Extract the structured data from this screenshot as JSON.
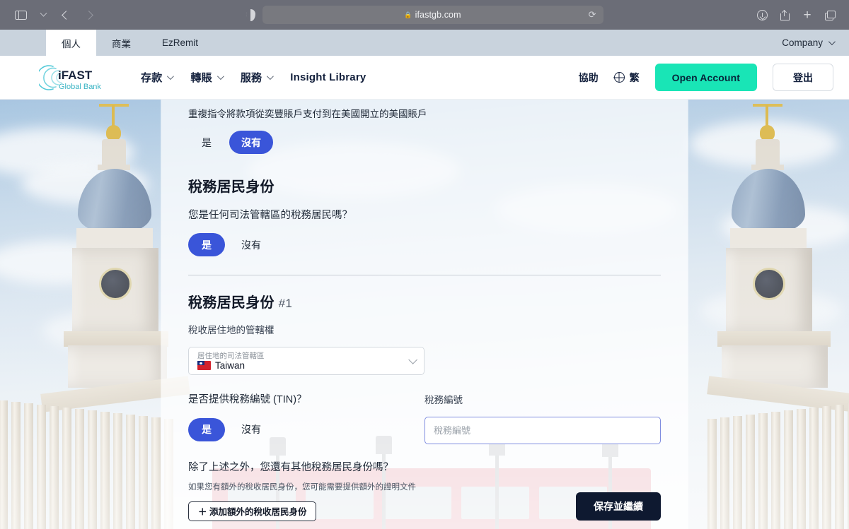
{
  "browser": {
    "url": "ifastgb.com",
    "lock_icon": "lock-icon",
    "sidebar_icon": "sidebar-toggle-icon",
    "back_icon": "back-arrow-icon",
    "forward_icon": "forward-arrow-icon",
    "shield_icon": "privacy-shield-icon",
    "reload_icon": "reload-icon",
    "download_icon": "download-icon",
    "share_icon": "share-icon",
    "newtab_icon": "plus-icon",
    "tabs_icon": "tab-overview-icon"
  },
  "tabstrip": {
    "tabs": [
      {
        "label": "個人",
        "active": true
      },
      {
        "label": "商業",
        "active": false
      },
      {
        "label": "EzRemit",
        "active": false
      }
    ],
    "company_label": "Company"
  },
  "sitenav": {
    "logo_primary": "iFAST",
    "logo_secondary": "Global Bank",
    "links": [
      {
        "label": "存款",
        "caret": true
      },
      {
        "label": "轉賬",
        "caret": true
      },
      {
        "label": "服務",
        "caret": true
      },
      {
        "label": "Insight Library",
        "caret": false
      }
    ],
    "help_label": "協助",
    "lang_label": "繁",
    "open_account_label": "Open Account",
    "logout_label": "登出"
  },
  "form": {
    "top_question": "重複指令將款項從奕豐賬戶支付到在美國開立的美國賬戶",
    "top_yes": "是",
    "top_no": "沒有",
    "top_selected": "no",
    "section1_title": "稅務居民身份",
    "section1_question": "您是任何司法管轄區的稅務居民嗎？",
    "section1_yes": "是",
    "section1_no": "沒有",
    "section1_selected": "yes",
    "section2_title": "稅務居民身份",
    "section2_index": "#1",
    "jurisdiction_label": "稅收居住地的管轄權",
    "select_mini_label": "居住地的司法管轄區",
    "select_value": "Taiwan",
    "select_flag": "taiwan-flag-icon",
    "tin_question": "是否提供稅務編號 (TIN)？",
    "tin_yes": "是",
    "tin_no": "沒有",
    "tin_selected": "yes",
    "tin_field_label": "稅務編號",
    "tin_placeholder": "稅務編號",
    "tin_value": "",
    "additional_question": "除了上述之外，您還有其他稅務居民身份嗎？",
    "additional_hint": "如果您有額外的稅收居民身份，您可能需要提供額外的證明文件",
    "add_button_label": "＋ 添加額外的稅收居民身份",
    "save_button_label": "保存並繼續"
  },
  "colors": {
    "accent_blue": "#3a55d9",
    "accent_teal": "#19e5b6",
    "dark_navy": "#0e1930",
    "tab_strip": "#c9d3dd",
    "chrome": "#6b6d77"
  }
}
